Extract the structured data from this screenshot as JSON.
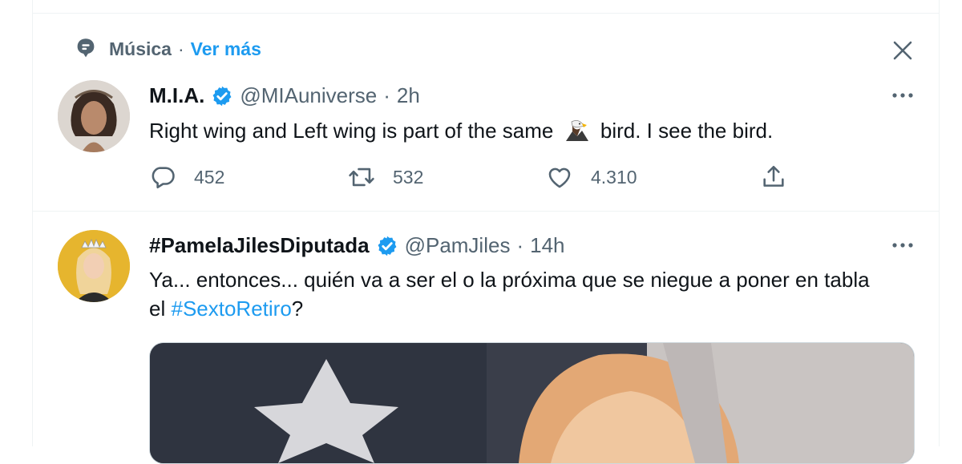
{
  "context": {
    "topic": "Música",
    "separator": "·",
    "see_more": "Ver más"
  },
  "tweets": [
    {
      "name": "M.I.A.",
      "handle": "@MIAuniverse",
      "separator": "·",
      "time": "2h",
      "text_before": "Right wing and Left wing is part of the same",
      "emoji": "eagle",
      "text_after": "bird.  I see the bird.",
      "replies": "452",
      "retweets": "532",
      "likes": "4.310"
    },
    {
      "name": "#PamelaJilesDiputada",
      "handle": "@PamJiles",
      "separator": "·",
      "time": "14h",
      "text_before": "Ya... entonces... quién va a ser el o la próxima que se niegue a poner en tabla el",
      "hashtag": "#SextoRetiro",
      "text_after": "?"
    }
  ],
  "icons": {
    "context": "topic-icon",
    "close": "close-icon",
    "more": "more-icon",
    "verified": "verified-badge-icon",
    "reply": "reply-icon",
    "retweet": "retweet-icon",
    "like": "like-icon",
    "share": "share-icon"
  },
  "colors": {
    "accent": "#1d9bf0",
    "muted": "#536471",
    "text": "#0f1419"
  }
}
